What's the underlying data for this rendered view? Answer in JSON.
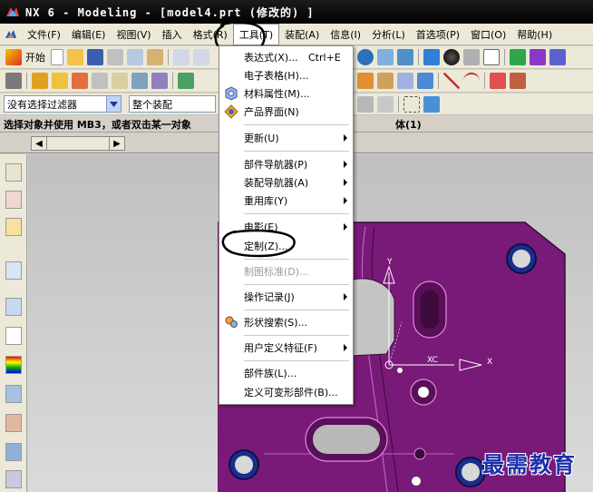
{
  "window": {
    "title": "NX 6 - Modeling - [model4.prt  (修改的) ]"
  },
  "menubar": {
    "items": [
      {
        "label": "文件(F)"
      },
      {
        "label": "编辑(E)"
      },
      {
        "label": "视图(V)"
      },
      {
        "label": "插入"
      },
      {
        "label": "格式(R)"
      },
      {
        "label": "工具(T)"
      },
      {
        "label": "装配(A)"
      },
      {
        "label": "信息(I)"
      },
      {
        "label": "分析(L)"
      },
      {
        "label": "首选项(P)"
      },
      {
        "label": "窗口(O)"
      },
      {
        "label": "帮助(H)"
      }
    ]
  },
  "toolbar": {
    "start_label": "开始"
  },
  "selection": {
    "filter_value": "没有选择过滤器",
    "scope_value": "整个装配"
  },
  "status": {
    "prompt": "选择对象并使用 MB3，或者双击某一对象",
    "right_text": "体(1)"
  },
  "tools_menu": {
    "items": [
      {
        "label": "表达式(X)...",
        "shortcut": "Ctrl+E"
      },
      {
        "label": "电子表格(H)..."
      },
      {
        "label": "材料属性(M)..."
      },
      {
        "label": "产品界面(N)"
      },
      {
        "label": "更新(U)"
      },
      {
        "label": "部件导航器(P)"
      },
      {
        "label": "装配导航器(A)"
      },
      {
        "label": "重用库(Y)"
      },
      {
        "label": "电影(E)"
      },
      {
        "label": "定制(Z)..."
      },
      {
        "label": "制图标准(D)..."
      },
      {
        "label": "操作记录(J)"
      },
      {
        "label": "形状搜索(S)..."
      },
      {
        "label": "用户定义特征(F)"
      },
      {
        "label": "部件族(L)..."
      },
      {
        "label": "定义可变形部件(B)..."
      }
    ]
  },
  "viewport": {
    "axis_x": "XC",
    "axis_y": "Y",
    "axis_x2": "X"
  },
  "watermark": "最需教育",
  "colors": {
    "part_purple": "#7a1a78",
    "hole_blue": "#1b2d8c",
    "menu_highlight_circle": "#000000"
  }
}
